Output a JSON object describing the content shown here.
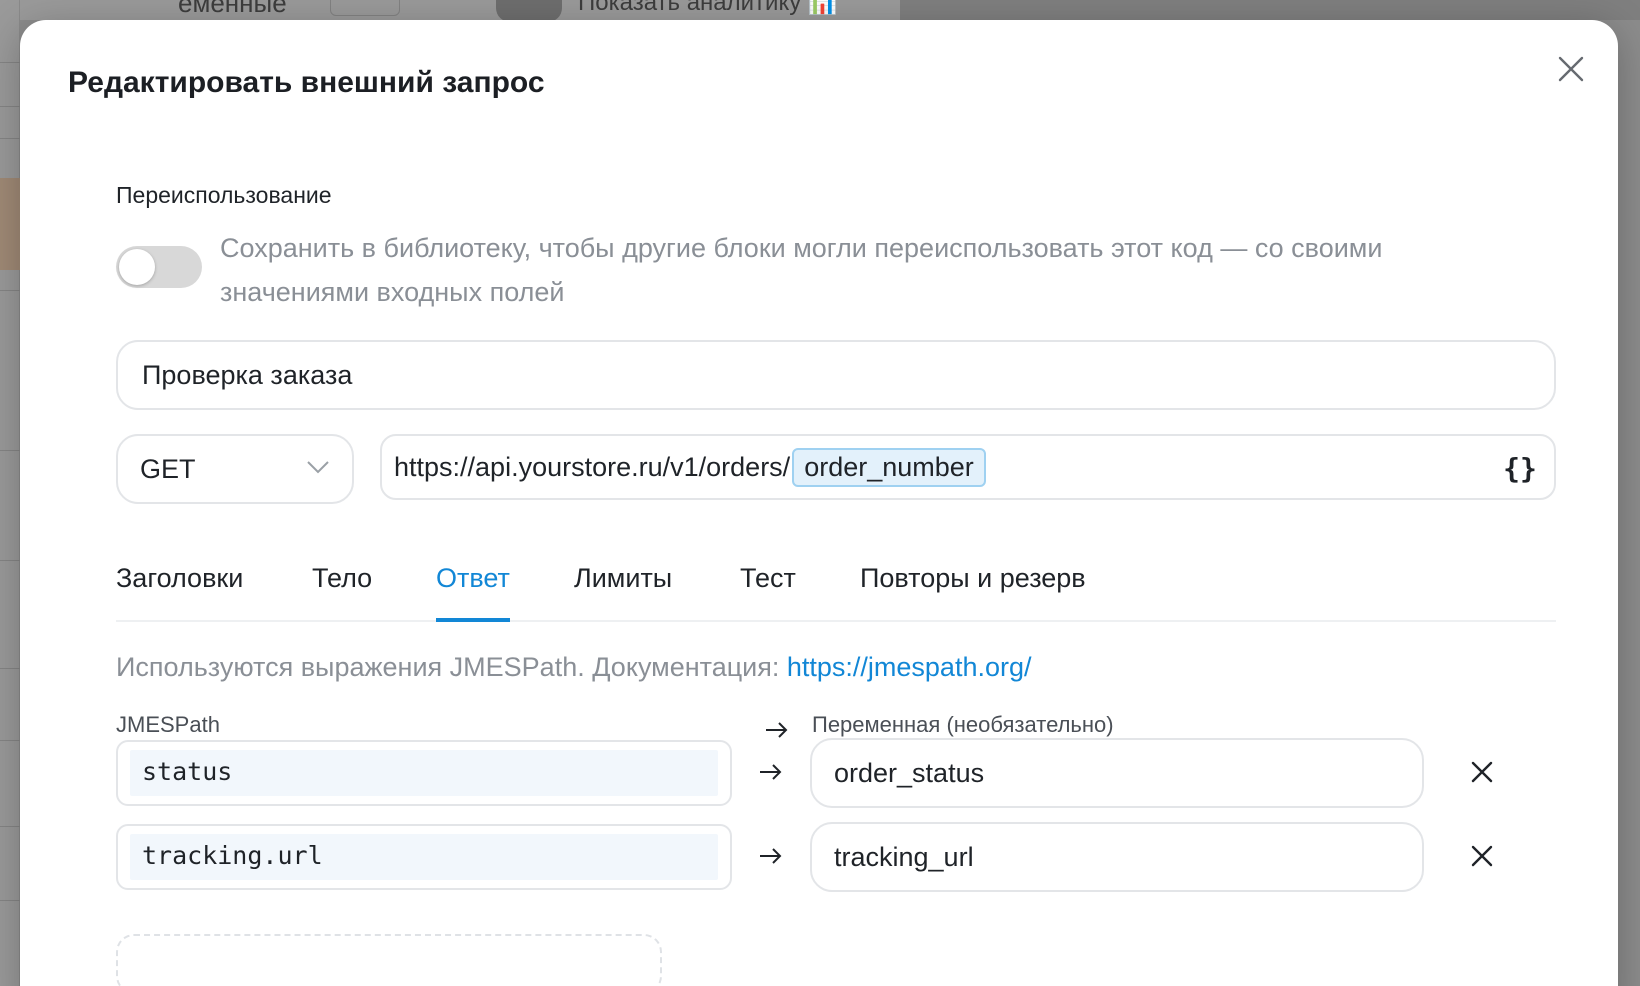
{
  "background": {
    "variables_label": "еменные",
    "more_label": "···",
    "analytics_label": "Показать аналитику"
  },
  "modal": {
    "title": "Редактировать внешний запрос",
    "reuse": {
      "section_label": "Переиспользование",
      "toggle_on": false,
      "description": "Сохранить в библиотеку, чтобы другие блоки могли переиспользовать этот код — со своими значениями входных полей"
    },
    "name_value": "Проверка заказа",
    "method": "GET",
    "url": {
      "base": "https://api.yourstore.ru/v1/orders/",
      "variable": "order_number",
      "braces_label": "{}"
    },
    "tabs": [
      {
        "label": "Заголовки",
        "active": false
      },
      {
        "label": "Тело",
        "active": false
      },
      {
        "label": "Ответ",
        "active": true
      },
      {
        "label": "Лимиты",
        "active": false
      },
      {
        "label": "Тест",
        "active": false
      },
      {
        "label": "Повторы и резерв",
        "active": false
      }
    ],
    "response": {
      "hint_text": "Используются выражения JMESPath. Документация: ",
      "hint_link": "https://jmespath.org/",
      "col_jmespath": "JMESPath",
      "col_variable": "Переменная (необязательно)",
      "rows": [
        {
          "jmespath": "status",
          "variable": "order_status"
        },
        {
          "jmespath": "tracking.url",
          "variable": "tracking_url"
        }
      ]
    }
  },
  "colors": {
    "accent": "#1287d6",
    "muted_text": "#8a8f96",
    "border": "#e3e5e8",
    "variable_chip_bg": "#e3f1fb"
  },
  "icons": {
    "close": "close-icon",
    "chevron": "chevron-down-icon",
    "arrow": "arrow-right-icon",
    "remove": "close-icon",
    "analytics": "bar-chart-icon"
  }
}
